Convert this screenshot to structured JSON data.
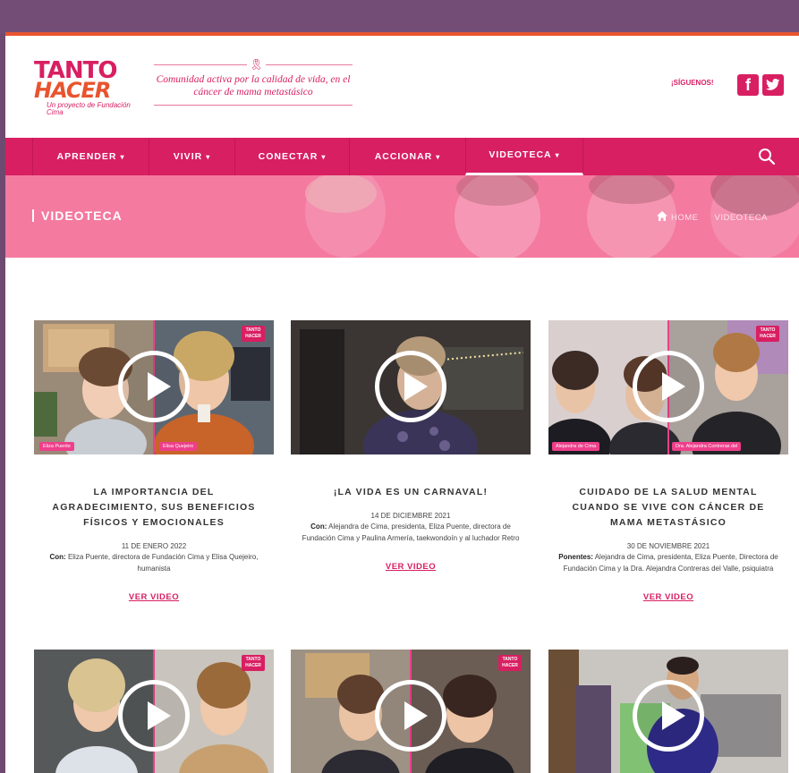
{
  "header": {
    "logo_line1": "TANTO",
    "logo_line2": "HACER",
    "logo_sub": "Un proyecto de Fundación Cima",
    "tagline": "Comunidad activa por la calidad de vida, en el cáncer de mama metastásico",
    "follow_label": "¡SÍGUENOS!",
    "facebook_glyph": "f",
    "twitter_glyph": "t"
  },
  "nav": {
    "items": [
      {
        "label": "APRENDER"
      },
      {
        "label": "VIVIR"
      },
      {
        "label": "CONECTAR"
      },
      {
        "label": "ACCIONAR"
      },
      {
        "label": "VIDEOTECA"
      }
    ],
    "caret": "▾",
    "active": "VIDEOTECA"
  },
  "hero": {
    "title": "VIDEOTECA",
    "crumb_home": "HOME",
    "crumb_current": "VIDEOTECA"
  },
  "cards": [
    {
      "title": "LA IMPORTANCIA DEL AGRADECIMIENTO, SUS BENEFICIOS FÍSICOS Y EMOCIONALES",
      "date": "11 DE ENERO 2022",
      "desc_label": "Con:",
      "desc": "Eliza Puente, directora de Fundación Cima y Elisa Quejeiro, humanista",
      "link": "VER VIDEO",
      "tags": [
        "Eliza Puente",
        "Elisa Quejeiro"
      ],
      "badge": "TANTO HACER"
    },
    {
      "title": "¡LA VIDA ES UN CARNAVAL!",
      "date": "14 DE DICIEMBRE 2021",
      "desc_label": "Con:",
      "desc": "Alejandra de Cima, presidenta, Eliza Puente, directora de Fundación Cima y Paulina Armería, taekwondoín y al luchador Retro",
      "link": "VER VIDEO",
      "tags": [],
      "badge": ""
    },
    {
      "title": "CUIDADO DE LA SALUD MENTAL CUANDO SE VIVE CON CÁNCER DE MAMA METASTÁSICO",
      "date": "30 DE NOVIEMBRE 2021",
      "desc_label": "Ponentes:",
      "desc": "Alejandra de Cima, presidenta, Eliza Puente, Directora de Fundación Cima y la Dra. Alejandra Contreras del Valle, psiquiatra",
      "link": "VER VIDEO",
      "tags": [
        "Alejandra de Cima",
        "Dra. Alejandra Contreras del"
      ],
      "badge": "TANTO HACER"
    }
  ],
  "row2_badges": [
    "TANTO HACER",
    "TANTO HACER"
  ],
  "colors": {
    "primary": "#d81f62",
    "hero_pink": "#f47aa0",
    "accent_orange": "#e8542e",
    "frame_purple": "#744d76"
  }
}
